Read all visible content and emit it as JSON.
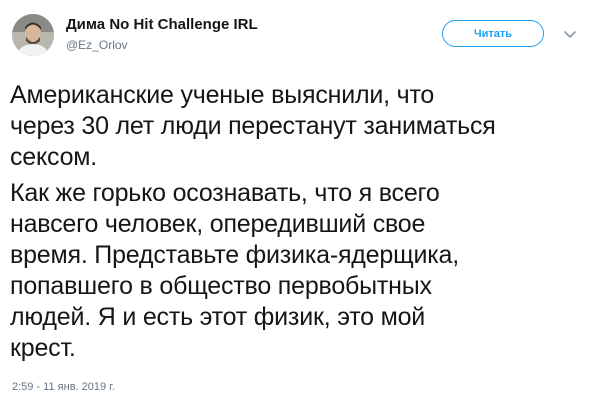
{
  "author": {
    "display_name": "Дима No Hit Challenge IRL",
    "handle": "@Ez_Orlov"
  },
  "follow_button": {
    "label": "Читать"
  },
  "icons": {
    "avatar": "avatar",
    "more_menu": "chevron-down-icon"
  },
  "colors": {
    "accent": "#1da1f2",
    "text": "#14171a",
    "muted": "#657786"
  },
  "tweet": {
    "paragraph_1": [
      "Американские ученые выяснили, что",
      "через 30 лет люди перестанут заниматься",
      "сексом."
    ],
    "paragraph_2": [
      "Как же горько осознавать, что я всего",
      "навсего человек, опередивший свое",
      "время. Представьте физика-ядерщика,",
      "попавшего в общество первобытных",
      "людей. Я и есть этот физик, это мой",
      "крест."
    ],
    "timestamp": "2:59 - 11 янв. 2019 г."
  }
}
